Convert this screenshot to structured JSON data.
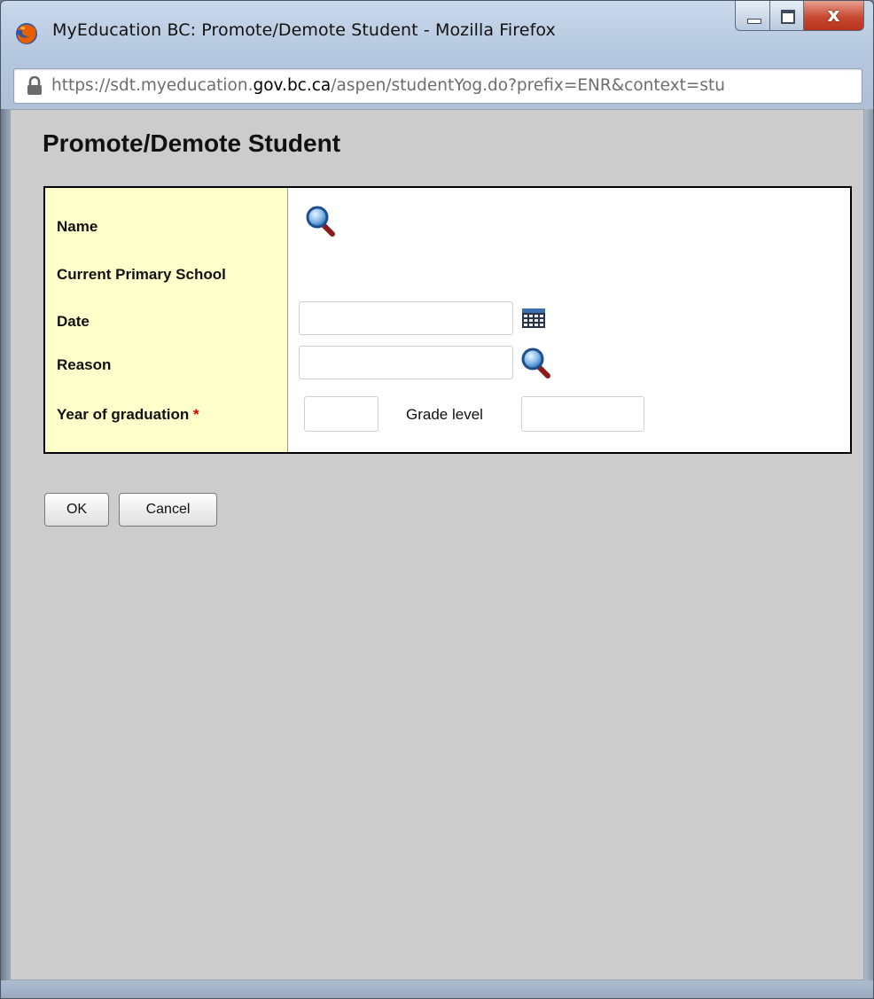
{
  "window": {
    "title": "MyEducation BC: Promote/Demote Student - Mozilla Firefox",
    "close_glyph": "x"
  },
  "urlbar": {
    "prefix": "https://sdt.myeducation.",
    "domain": "gov.bc.ca",
    "suffix": "/aspen/studentYog.do?prefix=ENR&context=stu"
  },
  "page": {
    "title": "Promote/Demote Student"
  },
  "form": {
    "name_label": "Name",
    "school_label": "Current Primary School",
    "date_label": "Date",
    "reason_label": "Reason",
    "yog_label": "Year of graduation",
    "required_marker": "*",
    "grade_level_label": "Grade level",
    "date_value": "",
    "reason_value": "",
    "yog_value": "",
    "grade_level_value": ""
  },
  "buttons": {
    "ok": "OK",
    "cancel": "Cancel"
  },
  "icons": {
    "app": "firefox-icon",
    "lock": "lock-icon",
    "search": "magnifier-icon",
    "calendar": "calendar-icon"
  },
  "colors": {
    "label_column": "#ffffcc",
    "content_bg": "#cccccc",
    "required": "#d40000"
  }
}
